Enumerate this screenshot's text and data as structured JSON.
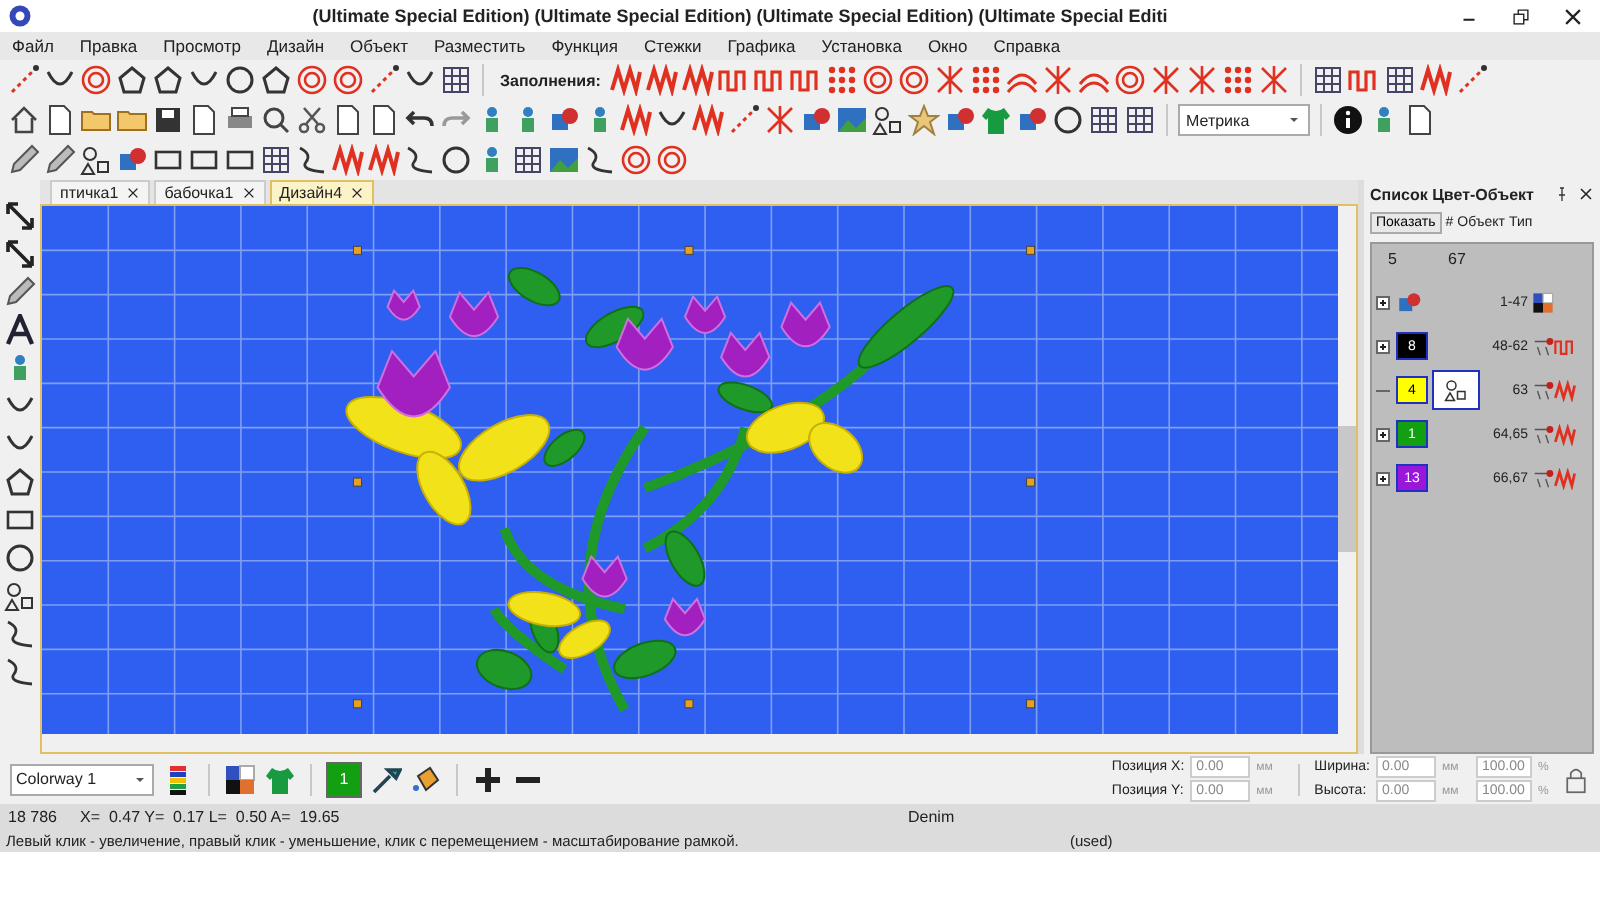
{
  "window": {
    "title": "(Ultimate Special Edition) (Ultimate Special Edition) (Ultimate Special Edition) (Ultimate Special Editi"
  },
  "menu": [
    "Файл",
    "Правка",
    "Просмотр",
    "Дизайн",
    "Объект",
    "Разместить",
    "Функция",
    "Стежки",
    "Графика",
    "Установка",
    "Окно",
    "Справка"
  ],
  "fills_label": "Заполнения:",
  "units_dropdown": {
    "value": "Метрика"
  },
  "tabs": [
    {
      "label": "птичка1",
      "selected": false
    },
    {
      "label": "бабочка1",
      "selected": false
    },
    {
      "label": "Дизайн4",
      "selected": true
    }
  ],
  "panel": {
    "title": "Список Цвет-Объект",
    "show_button": "Показать",
    "columns": [
      "#",
      "Объект",
      "Тип"
    ],
    "summary": [
      "5",
      "67"
    ],
    "rows": [
      {
        "kind": "group",
        "range": "1-47",
        "expanded": false,
        "selected": false
      },
      {
        "kind": "color",
        "number": "8",
        "color": "#000000",
        "range": "48-62",
        "expanded": false,
        "selected": false
      },
      {
        "kind": "color",
        "number": "4",
        "color": "#ffff00",
        "range": "63",
        "expanded": true,
        "selected": true
      },
      {
        "kind": "color",
        "number": "1",
        "color": "#12a012",
        "range": "64,65",
        "expanded": false,
        "selected": false
      },
      {
        "kind": "color",
        "number": "13",
        "color": "#9a16d8",
        "range": "66,67",
        "expanded": false,
        "selected": false
      }
    ]
  },
  "bottom": {
    "colorway": "Colorway 1",
    "color_button": {
      "number": "1",
      "color": "#12a012"
    },
    "fields": [
      {
        "label": "Позиция X:",
        "value": "0.00",
        "unit": "мм",
        "disabled": true
      },
      {
        "label": "Позиция Y:",
        "value": "0.00",
        "unit": "мм",
        "disabled": true
      }
    ],
    "size_fields": [
      {
        "label": "Ширина:",
        "value": "0.00",
        "unit": "мм",
        "percent": "100.00",
        "percent_unit": "%",
        "disabled": true
      },
      {
        "label": "Высота:",
        "value": "0.00",
        "unit": "мм",
        "percent": "100.00",
        "percent_unit": "%",
        "disabled": true
      }
    ]
  },
  "status_bar": {
    "stitches": "18 786",
    "coords": "X=  0.47 Y=  0.17 L=  0.50 A=  19.65",
    "fabric": "Denim",
    "message": "Левый клик - увеличение, правый клик - уменьшение, клик с перемещением - масштабирование рамкой.",
    "usage": "(used)"
  }
}
